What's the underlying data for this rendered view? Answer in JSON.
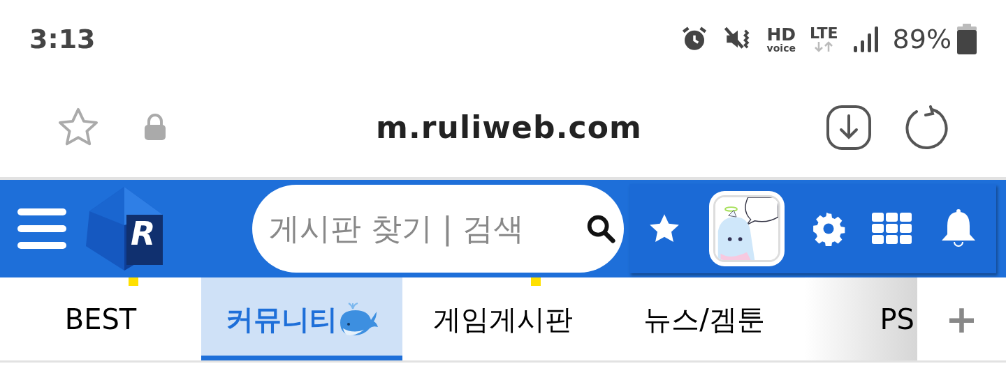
{
  "status_bar": {
    "time": "3:13",
    "hd": "HD",
    "voice": "voice",
    "network": "LTE",
    "battery": "89%"
  },
  "address_bar": {
    "url": "m.ruliweb.com"
  },
  "header": {
    "logo_letter": "R",
    "search": {
      "placeholder": "게시판 찾기 | 검색"
    }
  },
  "tabs": [
    {
      "label": "BEST",
      "selected": false,
      "marked": true,
      "emoji": false
    },
    {
      "label": "커뮤니티",
      "selected": true,
      "marked": false,
      "emoji": true
    },
    {
      "label": "게임게시판",
      "selected": false,
      "marked": true,
      "emoji": false
    },
    {
      "label": "뉴스/겜툰",
      "selected": false,
      "marked": false,
      "emoji": false
    },
    {
      "label": "PS",
      "selected": false,
      "marked": false,
      "emoji": false
    }
  ],
  "add_tab": "+"
}
